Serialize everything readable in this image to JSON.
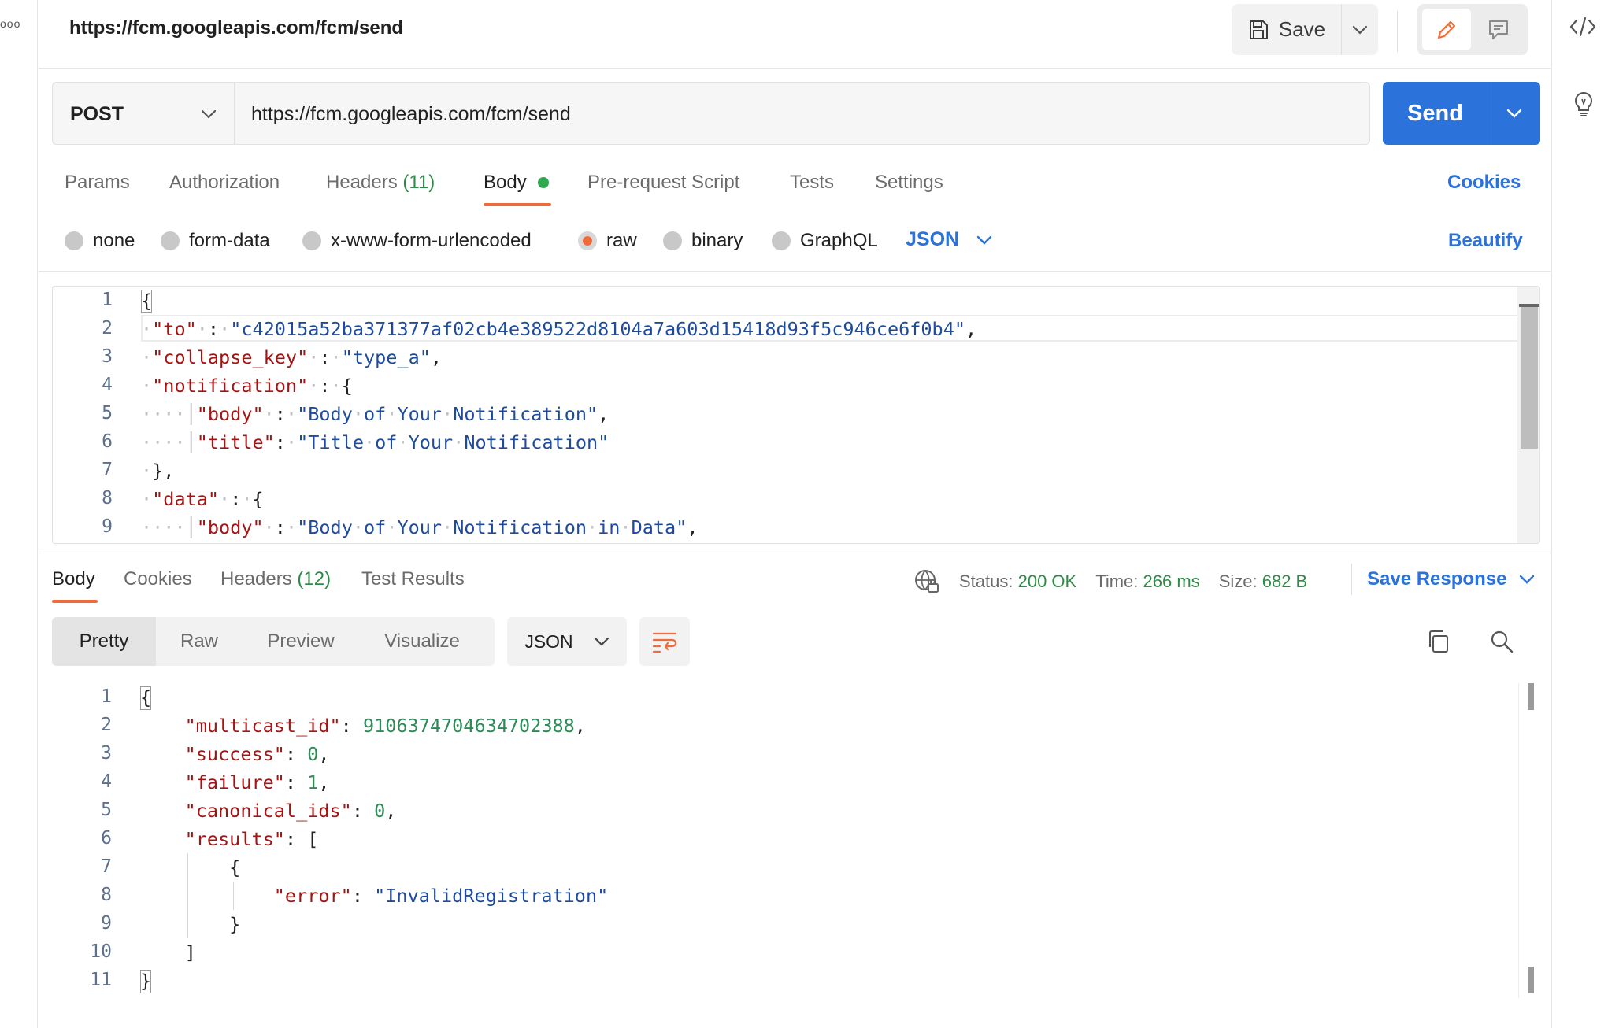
{
  "header": {
    "title": "https://fcm.googleapis.com/fcm/send",
    "save_label": "Save"
  },
  "request": {
    "method": "POST",
    "url": "https://fcm.googleapis.com/fcm/send",
    "send_label": "Send"
  },
  "request_tabs": [
    {
      "label": "Params"
    },
    {
      "label": "Authorization"
    },
    {
      "label": "Headers",
      "count": "(11)"
    },
    {
      "label": "Body"
    },
    {
      "label": "Pre-request Script"
    },
    {
      "label": "Tests"
    },
    {
      "label": "Settings"
    }
  ],
  "cookies_label": "Cookies",
  "body_modes": [
    {
      "label": "none"
    },
    {
      "label": "form-data"
    },
    {
      "label": "x-www-form-urlencoded"
    },
    {
      "label": "raw",
      "selected": true
    },
    {
      "label": "binary"
    },
    {
      "label": "GraphQL"
    }
  ],
  "body_language": "JSON",
  "beautify_label": "Beautify",
  "request_body": {
    "line_numbers": [
      "1",
      "2",
      "3",
      "4",
      "5",
      "6",
      "7",
      "8",
      "9"
    ]
  },
  "response_tabs": [
    {
      "label": "Body"
    },
    {
      "label": "Cookies"
    },
    {
      "label": "Headers",
      "count": "(12)"
    },
    {
      "label": "Test Results"
    }
  ],
  "response_status": {
    "status_label": "Status:",
    "status_value": "200 OK",
    "time_label": "Time:",
    "time_value": "266 ms",
    "size_label": "Size:",
    "size_value": "682 B"
  },
  "save_response_label": "Save Response",
  "view_modes": [
    {
      "label": "Pretty",
      "active": true
    },
    {
      "label": "Raw"
    },
    {
      "label": "Preview"
    },
    {
      "label": "Visualize"
    }
  ],
  "response_language": "JSON",
  "response_body": {
    "line_numbers": [
      "1",
      "2",
      "3",
      "4",
      "5",
      "6",
      "7",
      "8",
      "9",
      "10",
      "11"
    ]
  },
  "colors": {
    "accent": "#2b72db",
    "tab_indicator": "#ef6c3a",
    "success": "#2f8a47",
    "json_key": "#a31515",
    "json_string": "#1e4b9c",
    "json_number": "#2e8b57"
  }
}
